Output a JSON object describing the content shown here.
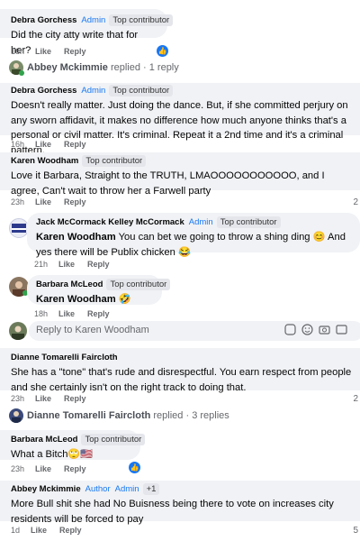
{
  "colors": {
    "accent": "#1877f2",
    "bubble": "#f0f2f5",
    "muted": "#65676b"
  },
  "c1": {
    "name": "Debra Gorchess",
    "role": "Admin",
    "badge": "Top contributor",
    "text": "Did the city atty write that for her?",
    "time": "16h",
    "like": "Like",
    "reply": "Reply"
  },
  "thread1": {
    "name": "Abbey Mckimmie",
    "suffix": "replied · 1 reply"
  },
  "c2": {
    "name": "Debra Gorchess",
    "role": "Admin",
    "badge": "Top contributor",
    "text": "Doesn't really matter. Just doing the dance. But, if she committed perjury on any sworn affidavit, it makes no difference how much anyone thinks that's a personal or civil matter. It's criminal. Repeat it a 2nd time and it's a criminal pattern.",
    "time": "16h",
    "like": "Like",
    "reply": "Reply"
  },
  "c3": {
    "name": "Karen Woodham",
    "badge": "Top contributor",
    "text": "Love it Barbara, Straight to the TRUTH, LMAOOOOOOOOOOO, and I agree, Can't wait to throw her a Farwell party",
    "time": "23h",
    "like": "Like",
    "reply": "Reply",
    "count": "2"
  },
  "c4": {
    "name": "Jack McCormack Kelley McCormack",
    "role": "Admin",
    "badge": "Top contributor",
    "tag": "Karen Woodham",
    "text": " You can bet we going to throw a shing ding 😊 And yes there will be Publix chicken 😂",
    "time": "21h",
    "like": "Like",
    "reply": "Reply"
  },
  "c5": {
    "name": "Barbara McLeod",
    "badge": "Top contributor",
    "tag": "Karen Woodham",
    "text": " 🤣",
    "time": "18h",
    "like": "Like",
    "reply": "Reply"
  },
  "replybox": {
    "placeholder": "Reply to Karen Woodham"
  },
  "c6": {
    "name": "Dianne Tomarelli Faircloth",
    "text": "She has a \"tone\" that's rude and disrespectful. You earn respect from people and she certainly isn't on the right track to doing that.",
    "time": "23h",
    "like": "Like",
    "reply": "Reply",
    "count": "2"
  },
  "thread2": {
    "name": "Dianne Tomarelli Faircloth",
    "suffix": "replied · 3 replies"
  },
  "c7": {
    "name": "Barbara McLeod",
    "badge": "Top contributor",
    "text": "What a Bitch🙄🇺🇸",
    "time": "23h",
    "like": "Like",
    "reply": "Reply"
  },
  "c8": {
    "name": "Abbey Mckimmie",
    "role": "Author",
    "extra": "Admin",
    "plus": "+1",
    "text": "More Bull shit she had No Buisness being there to vote on increases city residents will be forced to pay",
    "time": "1d",
    "like": "Like",
    "reply": "Reply",
    "count": "5"
  }
}
